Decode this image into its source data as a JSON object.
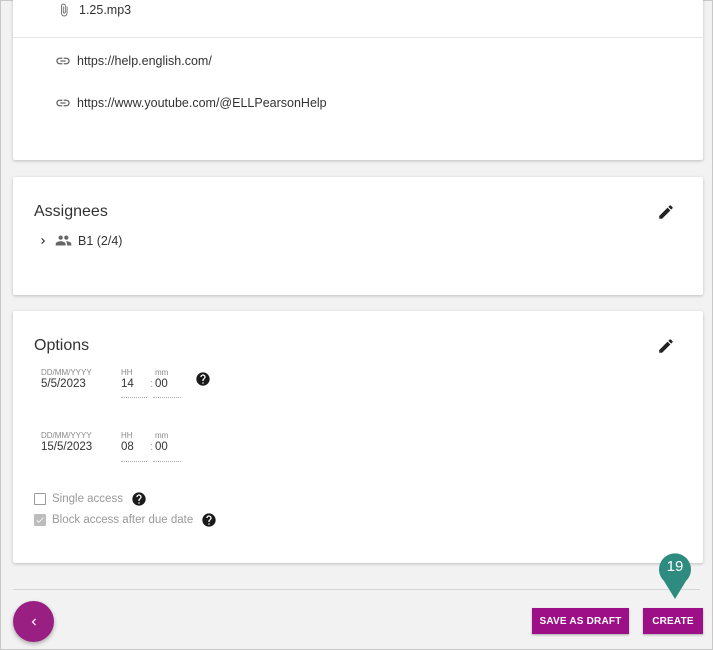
{
  "attachments": {
    "file_name": "1.25.mp3",
    "links": [
      "https://help.english.com/",
      "https://www.youtube.com/@ELLPearsonHelp"
    ]
  },
  "assignees": {
    "title": "Assignees",
    "group_label": "B1 (2/4)"
  },
  "options": {
    "title": "Options",
    "start": {
      "date_caption": "DD/MM/YYYY",
      "date": "5/5/2023",
      "hh_caption": "HH",
      "hh": "14",
      "mm_caption": "mm",
      "mm": "00"
    },
    "end": {
      "date_caption": "DD/MM/YYYY",
      "date": "15/5/2023",
      "hh_caption": "HH",
      "hh": "08",
      "mm_caption": "mm",
      "mm": "00"
    },
    "single_access": {
      "label": "Single access",
      "checked": false
    },
    "block_access": {
      "label": "Block access after due date",
      "checked": true
    }
  },
  "footer": {
    "save_draft_label": "SAVE AS DRAFT",
    "create_label": "CREATE",
    "step_number": "19"
  },
  "colors": {
    "primary": "#9c0f87",
    "marker": "#2e8b7f"
  }
}
